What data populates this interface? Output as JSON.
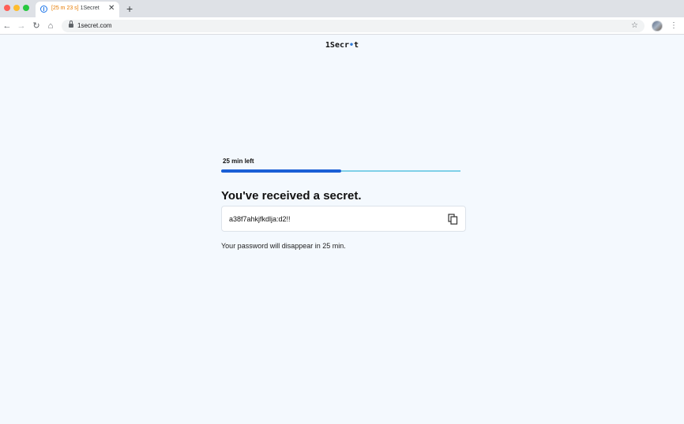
{
  "browser": {
    "tab": {
      "timer": "[25 m 23 s]",
      "title": "1Secret",
      "close": "✕"
    },
    "new_tab": "+",
    "url": "1secret.com",
    "toolbar_icons": [
      "back-arrow-icon",
      "forward-arrow-icon",
      "reload-icon",
      "home-icon",
      "lock-icon",
      "star-icon",
      "avatar",
      "menu-dots-icon"
    ]
  },
  "page": {
    "logo": {
      "prefix": "1Secr",
      "accent": "•",
      "suffix": "t"
    },
    "timer_label": "25 min left",
    "progress": 0.5,
    "colors": {
      "progress_fill": "#1a5fd6",
      "progress_track": "#7fd0e8",
      "background": "#f4f9fe"
    },
    "heading": "You've received a secret.",
    "secret": "a38f7ahkjfkdlja:d2!!",
    "copy_icon": "copy-icon",
    "note": "Your password will disappear in 25 min."
  }
}
